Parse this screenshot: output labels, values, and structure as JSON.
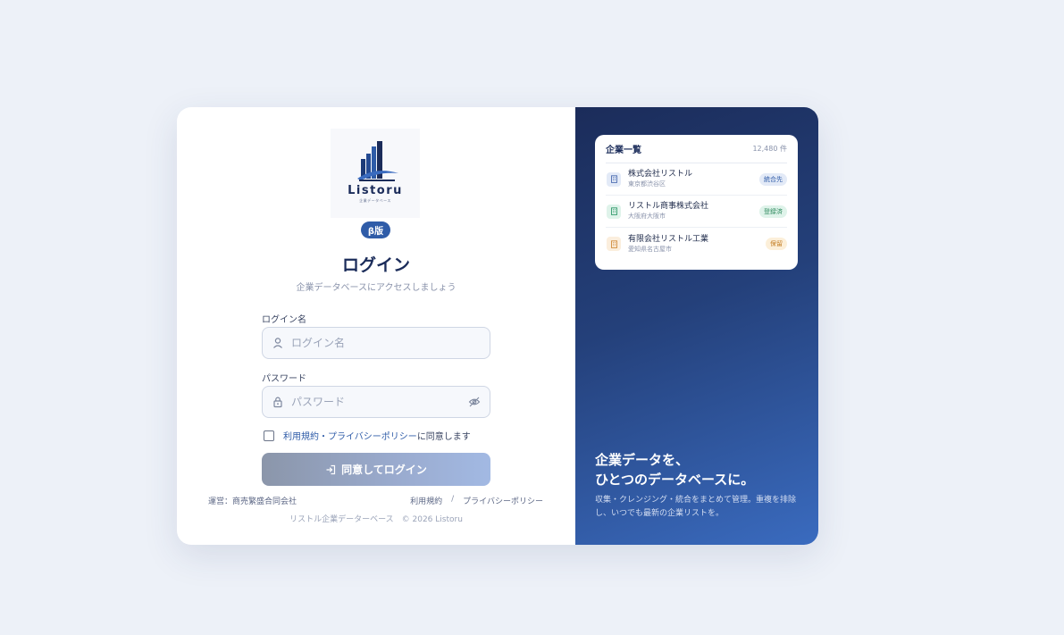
{
  "brand": {
    "logo_text": "Listoru",
    "logo_subtext": "企業データベース",
    "beta_label": "β版"
  },
  "login": {
    "title": "ログイン",
    "subtitle": "企業データベースにアクセスしましょう",
    "username": {
      "label": "ログイン名",
      "placeholder": "ログイン名",
      "value": ""
    },
    "password": {
      "label": "パスワード",
      "placeholder": "パスワード",
      "value": ""
    },
    "agree": {
      "checked": false,
      "link_text": "利用規約・プライバシーポリシー",
      "rest_text": "に同意します"
    },
    "submit_label": "同意してログイン"
  },
  "footer": {
    "operator": "運営：商売繁盛合同会社",
    "terms_link": "利用規約",
    "separator": "/",
    "privacy_link": "プライバシーポリシー",
    "copyright": "リストル企業データーベース　© 2026 Listoru"
  },
  "preview": {
    "title": "企業一覧",
    "count": "12,480 件",
    "companies": [
      {
        "name": "株式会社リストル",
        "location": "東京都渋谷区",
        "status": "統合先",
        "icon": "building-icon",
        "icon_bg": "#e3eaf7",
        "icon_color": "#4a6bb0",
        "badge_bg": "#e3eaf7",
        "badge_color": "#2f5ca8"
      },
      {
        "name": "リストル商事株式会社",
        "location": "大阪府大阪市",
        "status": "登録済",
        "icon": "building-icon",
        "icon_bg": "#dff3ea",
        "icon_color": "#2f9a6a",
        "badge_bg": "#dff3ea",
        "badge_color": "#2f8a5e"
      },
      {
        "name": "有限会社リストル工業",
        "location": "愛知県名古屋市",
        "status": "保留",
        "icon": "building-icon",
        "icon_bg": "#fbeedd",
        "icon_color": "#d08a3a",
        "badge_bg": "#fcefd9",
        "badge_color": "#c27a1f"
      }
    ]
  },
  "hero": {
    "tagline_line1": "企業データを、",
    "tagline_line2": "ひとつのデータベースに。",
    "description": "収集・クレンジング・統合をまとめて管理。重複を排除し、いつでも最新の企業リストを。"
  },
  "colors": {
    "page_bg": "#edf1f8",
    "brand_navy": "#1b2c5a",
    "accent_blue": "#2f5ca8"
  }
}
